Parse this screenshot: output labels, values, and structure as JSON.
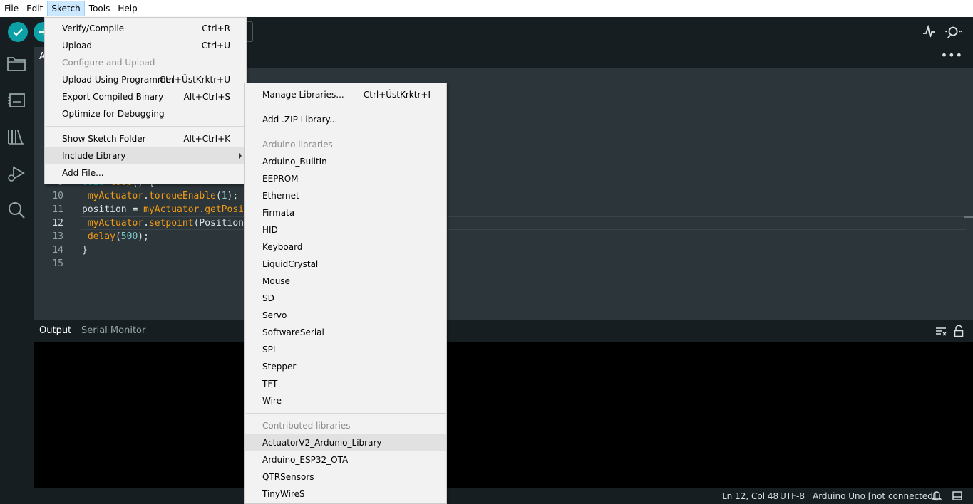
{
  "menubar": {
    "items": [
      "File",
      "Edit",
      "Sketch",
      "Tools",
      "Help"
    ]
  },
  "editor": {
    "tab_label": "A",
    "lines": [
      {
        "n": "9",
        "parts": [
          [
            "kw",
            "void"
          ],
          [
            "plain",
            " "
          ],
          [
            "fn",
            "loop"
          ],
          [
            "plain",
            "() {"
          ]
        ]
      },
      {
        "n": "10",
        "parts": [
          [
            "plain",
            " "
          ],
          [
            "fn",
            "myActuator"
          ],
          [
            "plain",
            "."
          ],
          [
            "fn",
            "torqueEnable"
          ],
          [
            "plain",
            "("
          ],
          [
            "num",
            "1"
          ],
          [
            "plain",
            ");"
          ]
        ]
      },
      {
        "n": "11",
        "parts": [
          [
            "plain",
            "position = "
          ],
          [
            "fn",
            "myActuator"
          ],
          [
            "plain",
            "."
          ],
          [
            "fn",
            "getPosit"
          ]
        ]
      },
      {
        "n": "12",
        "parts": [
          [
            "plain",
            " "
          ],
          [
            "fn",
            "myActuator"
          ],
          [
            "plain",
            "."
          ],
          [
            "fn",
            "setpoint"
          ],
          [
            "plain",
            "(PositionC"
          ]
        ]
      },
      {
        "n": "13",
        "parts": [
          [
            "plain",
            " "
          ],
          [
            "fn",
            "delay"
          ],
          [
            "plain",
            "("
          ],
          [
            "num",
            "500"
          ],
          [
            "plain",
            ");"
          ]
        ]
      },
      {
        "n": "14",
        "parts": [
          [
            "plain",
            "}"
          ]
        ]
      },
      {
        "n": "15",
        "parts": []
      }
    ],
    "current_line": "12"
  },
  "panel": {
    "tabs": [
      "Output",
      "Serial Monitor"
    ]
  },
  "status": {
    "position": "Ln 12, Col 48",
    "encoding": "UTF-8",
    "board": "Arduino Uno [not connected]"
  },
  "sketch_menu": {
    "verify": {
      "label": "Verify/Compile",
      "shortcut": "Ctrl+R"
    },
    "upload": {
      "label": "Upload",
      "shortcut": "Ctrl+U"
    },
    "configure_upload": {
      "label": "Configure and Upload"
    },
    "upload_programmer": {
      "label": "Upload Using Programmer",
      "shortcut": "Ctrl+ÜstKrktr+U"
    },
    "export_binary": {
      "label": "Export Compiled Binary",
      "shortcut": "Alt+Ctrl+S"
    },
    "optimize": {
      "label": "Optimize for Debugging"
    },
    "show_folder": {
      "label": "Show Sketch Folder",
      "shortcut": "Alt+Ctrl+K"
    },
    "include_library": {
      "label": "Include Library"
    },
    "add_file": {
      "label": "Add File..."
    }
  },
  "library_menu": {
    "manage": {
      "label": "Manage Libraries...",
      "shortcut": "Ctrl+ÜstKrktr+I"
    },
    "add_zip": {
      "label": "Add .ZIP Library..."
    },
    "arduino_header": "Arduino libraries",
    "arduino_libraries": [
      "Arduino_BuiltIn",
      "EEPROM",
      "Ethernet",
      "Firmata",
      "HID",
      "Keyboard",
      "LiquidCrystal",
      "Mouse",
      "SD",
      "Servo",
      "SoftwareSerial",
      "SPI",
      "Stepper",
      "TFT",
      "Wire"
    ],
    "contributed_header": "Contributed libraries",
    "contributed_libraries": [
      "ActuatorV2_Ardunio_Library",
      "Arduino_ESP32_OTA",
      "QTRSensors",
      "TinyWireS"
    ],
    "highlighted": "ActuatorV2_Ardunio_Library"
  },
  "colors": {
    "accent": "#0ca1a6",
    "function": "#f39c12",
    "background": "#171e21",
    "editor": "#2c353a"
  },
  "icons": [
    "verify-check-icon",
    "upload-arrow-icon",
    "serial-plotter-icon",
    "serial-monitor-icon",
    "folder-icon",
    "board-icon",
    "library-icon",
    "debug-icon",
    "search-icon",
    "clear-output-icon",
    "lock-icon",
    "bell-icon",
    "panel-toggle-icon"
  ]
}
